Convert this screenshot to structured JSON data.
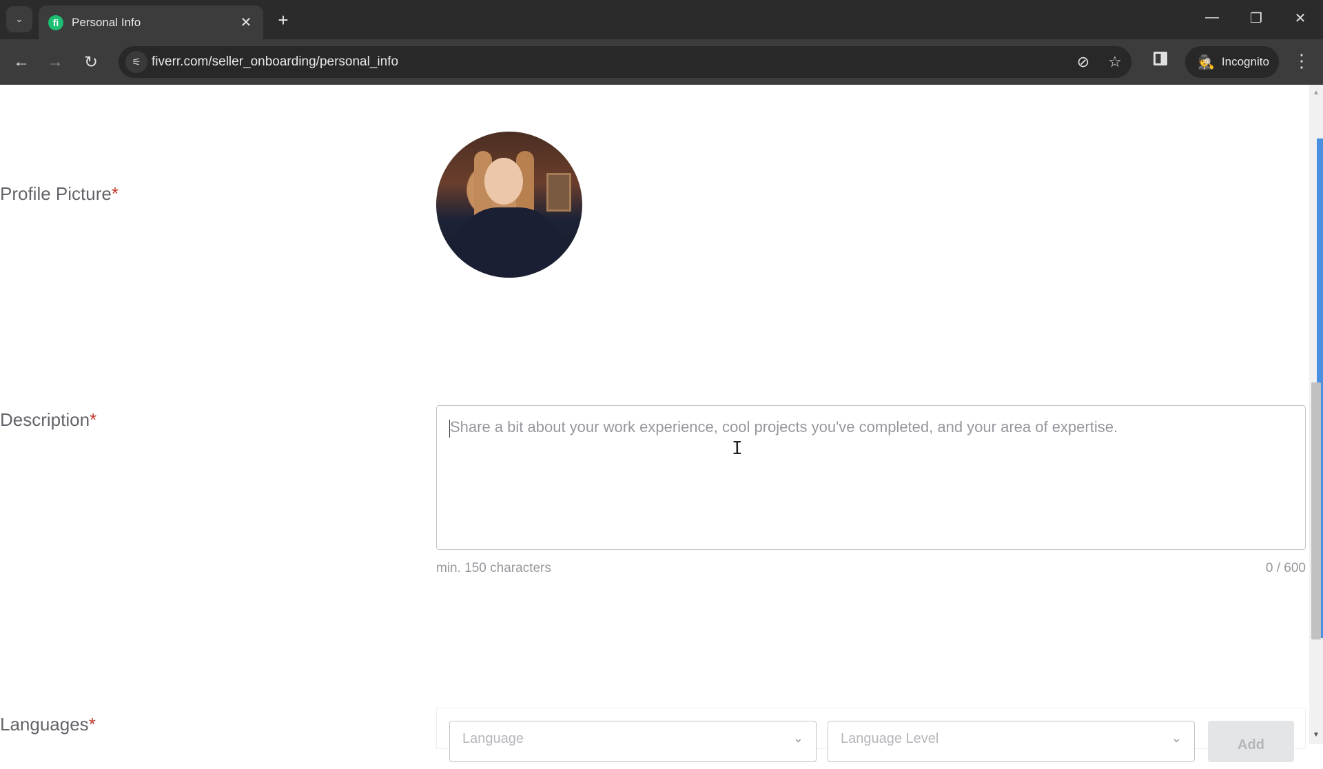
{
  "browser": {
    "tab": {
      "title": "Personal Info",
      "favicon": "fiverr-logo-icon",
      "favicon_text": "fi"
    },
    "icons": {
      "tab_search": "⌄",
      "tab_close": "✕",
      "new_tab": "+",
      "minimize": "—",
      "restore": "❐",
      "close": "✕",
      "back": "←",
      "forward": "→",
      "reload": "↻",
      "site_info": "⚟",
      "eye_off": "⊘",
      "bookmark": "☆",
      "incognito": "🕵",
      "menu": "⋮"
    },
    "url": "fiverr.com/seller_onboarding/personal_info",
    "incognito_label": "Incognito"
  },
  "form": {
    "profile_picture": {
      "label": "Profile Picture",
      "required_mark": "*"
    },
    "description": {
      "label": "Description",
      "required_mark": "*",
      "placeholder": "Share a bit about your work experience, cool projects you've completed, and your area of expertise.",
      "value": "",
      "min_hint": "min. 150 characters",
      "char_count": "0 / 600"
    },
    "languages": {
      "label": "Languages",
      "required_mark": "*",
      "language_placeholder": "Language",
      "level_placeholder": "Language Level",
      "chevron": "⌄",
      "add_label": "Add"
    }
  },
  "cursor": "I",
  "scrollbar": {
    "up": "▲",
    "down": "▼"
  },
  "colors": {
    "required": "#c0392b",
    "fiverr_green": "#1dbf73",
    "scroll_accent": "#4a8fe0"
  }
}
